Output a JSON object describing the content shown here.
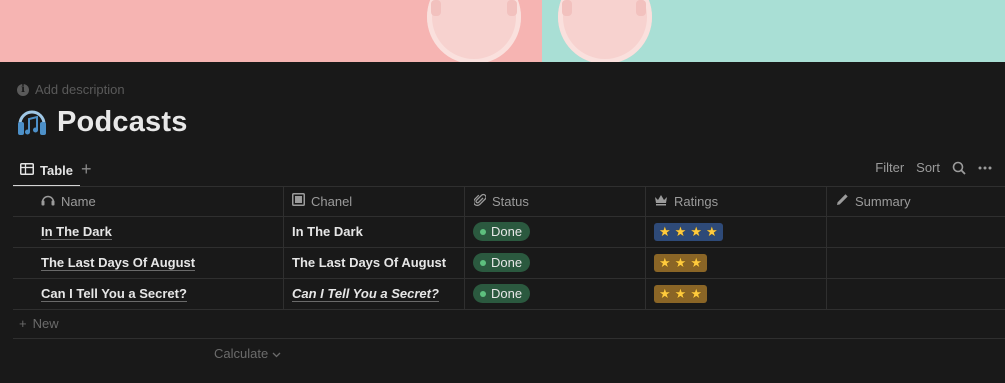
{
  "cover": {
    "left_color": "#f6b4b2",
    "right_color": "#a9dfd5"
  },
  "header": {
    "add_description": "Add description",
    "title": "Podcasts",
    "icon": "headphones-music-icon"
  },
  "tabs": [
    {
      "label": "Table",
      "icon": "table-icon"
    }
  ],
  "toolbar": {
    "filter": "Filter",
    "sort": "Sort"
  },
  "table": {
    "columns": [
      {
        "label": "Name",
        "icon": "headphones-icon"
      },
      {
        "label": "Chanel",
        "icon": "square-icon"
      },
      {
        "label": "Status",
        "icon": "paperclip-icon"
      },
      {
        "label": "Ratings",
        "icon": "crown-icon"
      },
      {
        "label": "Summary",
        "icon": "pencil-icon"
      }
    ],
    "rows": [
      {
        "name": "In The Dark",
        "chanel": "In The Dark",
        "status": "Done",
        "rating": "★★★★",
        "rating_color": "#2e4a78",
        "summary": ""
      },
      {
        "name": "The Last Days Of August",
        "chanel": "The Last Days Of August",
        "status": "Done",
        "rating": "★★★",
        "rating_color": "#8a6526",
        "summary": ""
      },
      {
        "name": "Can I Tell You a Secret?",
        "chanel": "Can I Tell You a Secret?",
        "status": "Done",
        "rating": "★★★",
        "rating_color": "#8a6526",
        "summary": ""
      }
    ],
    "status_color": "#2b593f"
  },
  "footer": {
    "new_label": "New",
    "calculate_label": "Calculate"
  }
}
